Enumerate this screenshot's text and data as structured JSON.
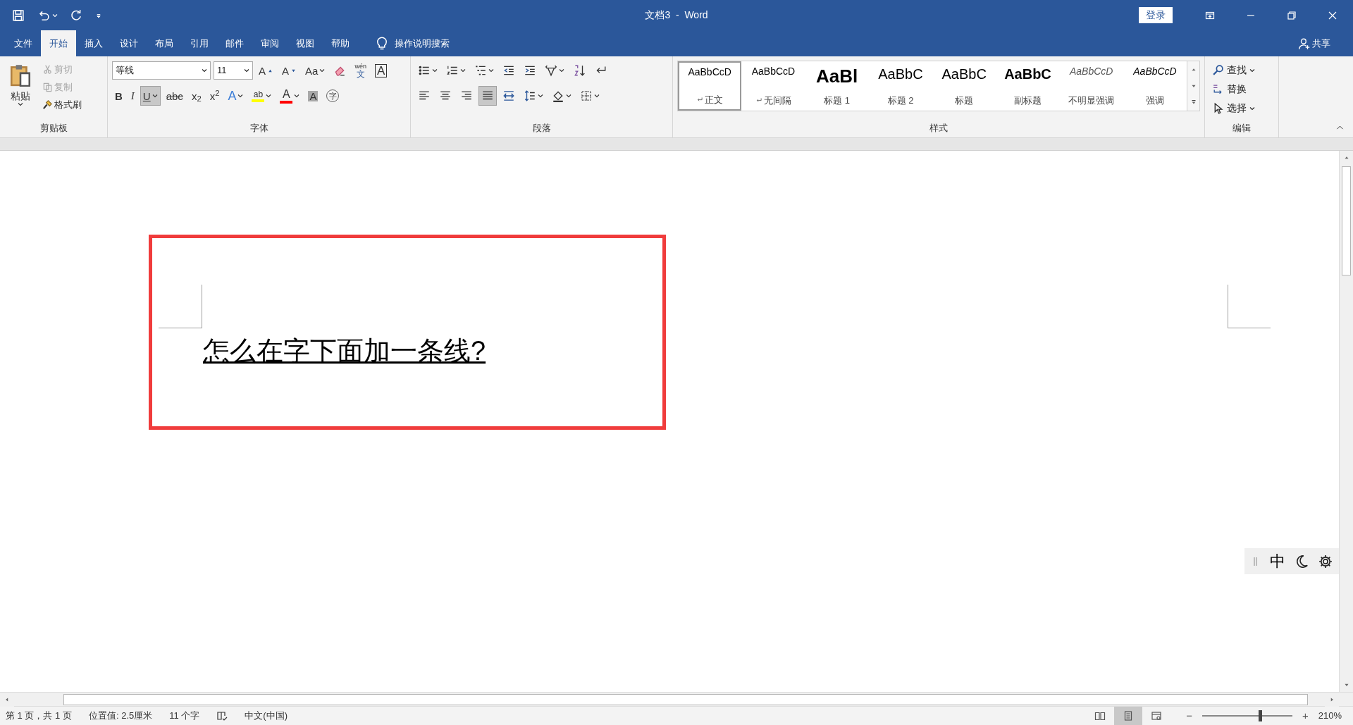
{
  "title_bar": {
    "quick_access": [
      {
        "kind": "save"
      },
      {
        "kind": "undo",
        "caret": true
      },
      {
        "kind": "redo"
      },
      {
        "kind": "customize"
      }
    ],
    "title": "文档3  -  Word",
    "login": "登录",
    "window_controls": [
      {
        "kind": "ribbonopt"
      },
      {
        "kind": "minimize"
      },
      {
        "kind": "restore"
      },
      {
        "kind": "close"
      }
    ]
  },
  "tabs": [
    {
      "label": "文件",
      "selected": false
    },
    {
      "label": "开始",
      "selected": true
    },
    {
      "label": "插入",
      "selected": false
    },
    {
      "label": "设计",
      "selected": false
    },
    {
      "label": "布局",
      "selected": false
    },
    {
      "label": "引用",
      "selected": false
    },
    {
      "label": "邮件",
      "selected": false
    },
    {
      "label": "审阅",
      "selected": false
    },
    {
      "label": "视图",
      "selected": false
    },
    {
      "label": "帮助",
      "selected": false
    }
  ],
  "tell_me": "操作说明搜索",
  "share": "共享",
  "ribbon": {
    "clipboard": {
      "label": "剪贴板",
      "paste": "粘贴",
      "items": [
        {
          "kind": "cut",
          "label": "剪切",
          "disabled": true
        },
        {
          "kind": "copy",
          "label": "复制",
          "disabled": true
        },
        {
          "kind": "painter",
          "label": "格式刷",
          "disabled": false
        }
      ]
    },
    "font": {
      "label": "字体",
      "font_name": "等线",
      "font_size": "11",
      "row1": [
        {
          "kind": "grow",
          "label": "A"
        },
        {
          "kind": "shrink",
          "label": "A"
        },
        {
          "kind": "case",
          "label": "Aa",
          "caret": true
        },
        {
          "kind": "clear"
        },
        {
          "kind": "phonetic",
          "label": "wén",
          "sub": "文"
        },
        {
          "kind": "border",
          "label": "A"
        }
      ],
      "row2": [
        {
          "kind": "bold",
          "label": "B",
          "selected": false
        },
        {
          "kind": "italic",
          "label": "I",
          "selected": false
        },
        {
          "kind": "underline",
          "label": "U",
          "selected": true,
          "caret": true
        },
        {
          "kind": "strike",
          "label": "abc",
          "selected": false
        },
        {
          "kind": "sub",
          "label": "x$_{2}$",
          "selected": false
        },
        {
          "kind": "sup",
          "label": "x$^{2}$",
          "selected": false
        },
        {
          "kind": "effect",
          "label": "A",
          "caret": true
        },
        {
          "kind": "highlight",
          "label": "ab",
          "color": "#ffff00",
          "caret": true
        },
        {
          "kind": "fontcolor",
          "label": "A",
          "color": "#ff0000",
          "caret": true
        },
        {
          "kind": "shading",
          "label": "A"
        },
        {
          "kind": "enclose",
          "label": "字"
        }
      ]
    },
    "paragraph": {
      "label": "段落",
      "row1": [
        {
          "kind": "bullets",
          "caret": true
        },
        {
          "kind": "numbering",
          "caret": true
        },
        {
          "kind": "multilevel",
          "caret": true
        },
        {
          "kind": "outdent"
        },
        {
          "kind": "indent"
        },
        {
          "kind": "asian",
          "caret": true
        },
        {
          "kind": "sort"
        },
        {
          "kind": "marks"
        }
      ],
      "row2": [
        {
          "kind": "left",
          "selected": false
        },
        {
          "kind": "center",
          "selected": false
        },
        {
          "kind": "right",
          "selected": false
        },
        {
          "kind": "justify",
          "selected": true
        },
        {
          "kind": "distributed",
          "selected": false
        },
        {
          "kind": "spacing",
          "caret": true
        },
        {
          "kind": "fill",
          "caret": true
        },
        {
          "kind": "borders",
          "caret": true
        }
      ]
    },
    "styles": {
      "label": "样式",
      "items": [
        {
          "preview": "AaBbCcD",
          "name": "正文",
          "kind": "normal",
          "para_mark": true,
          "selected": true
        },
        {
          "preview": "AaBbCcD",
          "name": "无间隔",
          "kind": "normal",
          "para_mark": true,
          "selected": false
        },
        {
          "preview": "AaBl",
          "name": "标题 1",
          "kind": "heading1",
          "selected": false
        },
        {
          "preview": "AaBbC",
          "name": "标题 2",
          "kind": "heading2",
          "selected": false
        },
        {
          "preview": "AaBbC",
          "name": "标题",
          "kind": "title",
          "selected": false
        },
        {
          "preview": "AaBbC",
          "name": "副标题",
          "kind": "subtitle",
          "selected": false
        },
        {
          "preview": "AaBbCcD",
          "name": "不明显强调",
          "kind": "subtle",
          "selected": false
        },
        {
          "preview": "AaBbCcD",
          "name": "强调",
          "kind": "emphasis",
          "selected": false
        }
      ]
    },
    "editing": {
      "label": "编辑",
      "items": [
        {
          "kind": "find",
          "label": "查找",
          "caret": true
        },
        {
          "kind": "replace",
          "label": "替换"
        },
        {
          "kind": "select",
          "label": "选择",
          "caret": true
        }
      ]
    }
  },
  "document": {
    "text": "怎么在字下面加一条线?",
    "underline": true,
    "frame": true
  },
  "ime_toolbar": {
    "mode": "中"
  },
  "status_bar": {
    "page": "第 1 页，共 1 页",
    "position": "位置值: 2.5厘米",
    "words": "11 个字",
    "language": "中文(中国)",
    "views": [
      {
        "kind": "read",
        "selected": false
      },
      {
        "kind": "print",
        "selected": true
      },
      {
        "kind": "web",
        "selected": false
      }
    ],
    "zoom_out": "−",
    "zoom_in": "+",
    "zoom": {
      "level": 0.64
    },
    "zoom_percent": "210%"
  }
}
